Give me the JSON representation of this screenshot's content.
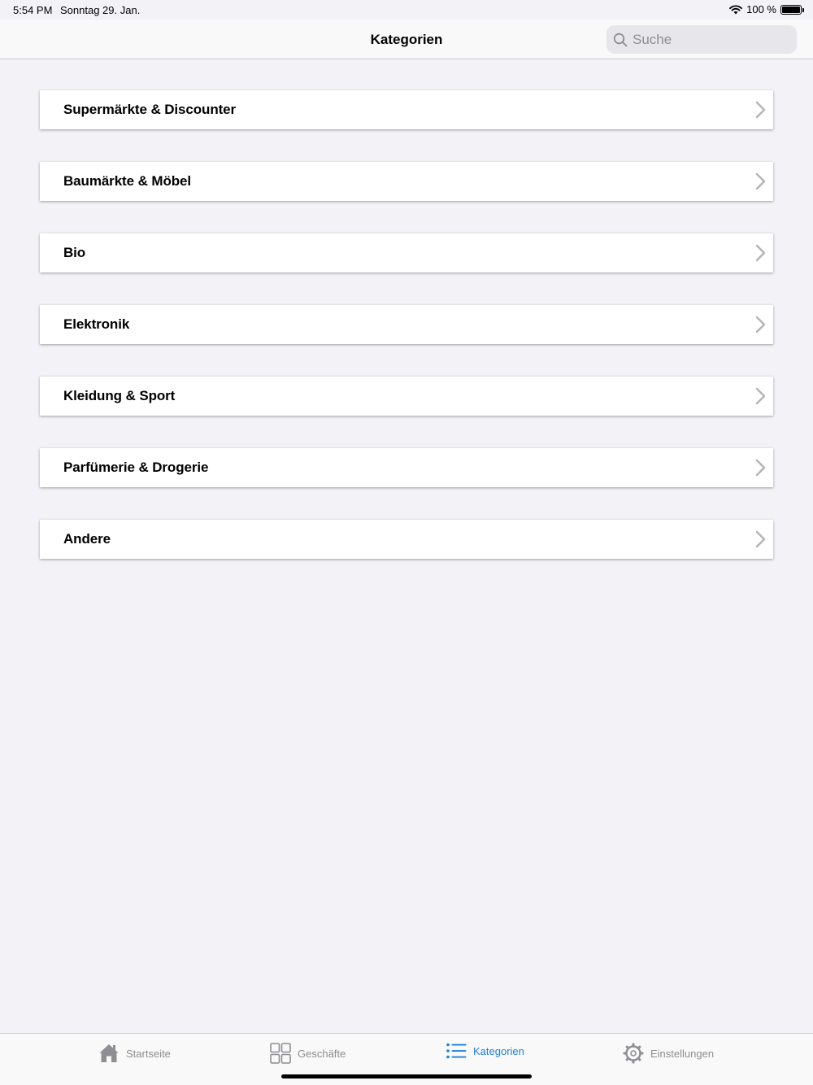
{
  "status_bar": {
    "time": "5:54 PM",
    "date": "Sonntag 29. Jan.",
    "battery": "100 %"
  },
  "nav": {
    "title": "Kategorien",
    "search_placeholder": "Suche"
  },
  "categories": [
    {
      "label": "Supermärkte & Discounter"
    },
    {
      "label": "Baumärkte & Möbel"
    },
    {
      "label": "Bio"
    },
    {
      "label": "Elektronik"
    },
    {
      "label": "Kleidung & Sport"
    },
    {
      "label": "Parfümerie & Drogerie"
    },
    {
      "label": "Andere"
    }
  ],
  "tabs": [
    {
      "label": "Startseite",
      "icon": "house-icon"
    },
    {
      "label": "Geschäfte",
      "icon": "grid-icon"
    },
    {
      "label": "Kategorien",
      "icon": "list-icon",
      "active": true
    },
    {
      "label": "Einstellungen",
      "icon": "gear-icon"
    }
  ],
  "colors": {
    "accent": "#1a7fe0",
    "inactive_tab": "#8e8e93",
    "background": "#f2f2f7",
    "chevron": "#b3b3b8"
  }
}
